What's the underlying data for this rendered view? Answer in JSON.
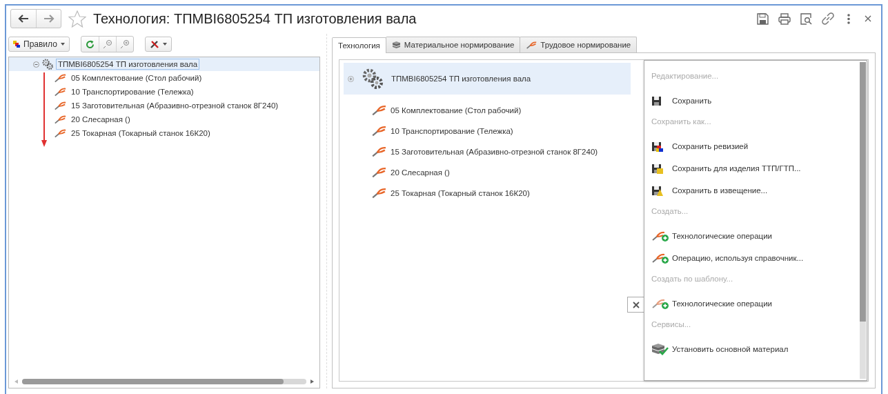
{
  "window": {
    "title": "Технология: ТПМВІ6805254 ТП изготовления вала",
    "favorite": false
  },
  "left_toolbar": {
    "rule_button": "Правило"
  },
  "tree": {
    "items": [
      {
        "label": "ТПМВІ6805254 ТП изготовления вала",
        "kind": "process",
        "expanded": true,
        "selected": true,
        "children": [
          {
            "label": "05 Комплектование (Стол рабочий)",
            "kind": "operation",
            "selected": false
          },
          {
            "label": "10 Транспортирование (Тележка)",
            "kind": "operation",
            "selected": false
          },
          {
            "label": "15 Заготовительная (Абразивно-отрезной станок 8Г240)",
            "kind": "operation",
            "selected": false
          },
          {
            "label": "20 Слесарная ()",
            "kind": "operation",
            "selected": false
          },
          {
            "label": "25 Токарная (Токарный станок 16К20)",
            "kind": "operation",
            "selected": false
          }
        ]
      }
    ]
  },
  "tabs": [
    {
      "label": "Технология",
      "kind": "plain",
      "selected": true
    },
    {
      "label": "Материальное нормирование",
      "kind": "materials",
      "selected": false
    },
    {
      "label": "Трудовое нормирование",
      "kind": "labor",
      "selected": false
    }
  ],
  "diagram": {
    "root": {
      "label": "ТПМВІ6805254 ТП изготовления вала"
    },
    "operations": [
      {
        "label": "05 Комплектование (Стол рабочий)"
      },
      {
        "label": "10 Транспортирование (Тележка)"
      },
      {
        "label": "15 Заготовительная (Абразивно-отрезной станок 8Г240)"
      },
      {
        "label": "20 Слесарная ()"
      },
      {
        "label": "25 Токарная (Токарный станок 16К20)"
      }
    ]
  },
  "menu": {
    "items": [
      {
        "kind": "header",
        "label": "Редактирование..."
      },
      {
        "kind": "save",
        "label": "Сохранить"
      },
      {
        "kind": "header",
        "label": "Сохранить как..."
      },
      {
        "kind": "save-revision",
        "label": "Сохранить ревизией"
      },
      {
        "kind": "save-product",
        "label": "Сохранить для изделия ТТП/ГТП..."
      },
      {
        "kind": "save-notice",
        "label": "Сохранить в извещение..."
      },
      {
        "kind": "header",
        "label": "Создать..."
      },
      {
        "kind": "op-add",
        "label": "Технологические операции"
      },
      {
        "kind": "op-add",
        "label": "Операцию, используя справочник..."
      },
      {
        "kind": "header",
        "label": "Создать по шаблону..."
      },
      {
        "kind": "op-template",
        "label": "Технологические операции"
      },
      {
        "kind": "header",
        "label": "Сервисы..."
      },
      {
        "kind": "material",
        "label": "Установить основной материал"
      }
    ]
  }
}
